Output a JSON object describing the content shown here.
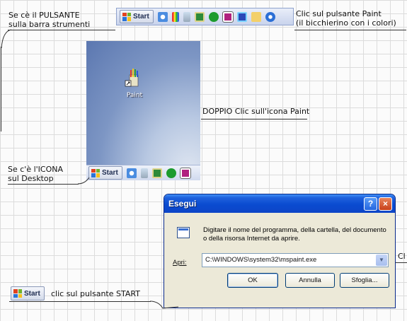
{
  "notes": {
    "toolbar_label": [
      "Se cè il PULSANTE",
      "sulla barra strumenti"
    ],
    "click_paint_button": [
      "Clic sul pulsante Paint",
      "(il bicchierino con i colori)"
    ],
    "double_click_icon": "DOPPIO Clic sull'icona Paint",
    "desktop_label": [
      "Se c'è l'ICONA",
      "sul Desktop"
    ],
    "cut_off_text": "Cl",
    "start_hint": "clic sul pulsante START"
  },
  "taskbar": {
    "start_label": "Start"
  },
  "desktop": {
    "icon_label": "Paint"
  },
  "dialog": {
    "title": "Esegui",
    "help_label": "?",
    "close_label": "×",
    "description": "Digitare il nome del programma, della cartella, del documento o della risorsa Internet da aprire.",
    "field_label": "Apri:",
    "field_value": "C:\\WINDOWS\\system32\\mspaint.exe",
    "buttons": {
      "ok": "OK",
      "cancel": "Annulla",
      "browse": "Sfoglia..."
    }
  },
  "colors": {
    "titlebar_blue": "#0a4bd0",
    "close_red": "#c7401a",
    "dialog_bg": "#ece9d8"
  }
}
